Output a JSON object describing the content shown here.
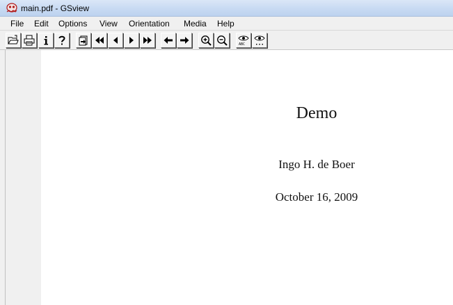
{
  "window": {
    "title": "main.pdf - GSview",
    "app_icon": "gsview-ghost-icon"
  },
  "menu": {
    "items": [
      {
        "label": "File"
      },
      {
        "label": "Edit"
      },
      {
        "label": "Options"
      },
      {
        "label": "View"
      },
      {
        "label": "Orientation"
      },
      {
        "label": "Media"
      },
      {
        "label": "Help"
      }
    ]
  },
  "toolbar": {
    "buttons": [
      {
        "icon": "open-folder-icon"
      },
      {
        "icon": "print-icon"
      },
      {
        "icon": "info-icon"
      },
      {
        "icon": "help-question-icon"
      },
      {
        "icon": "goto-page-icon"
      },
      {
        "icon": "first-page-icon"
      },
      {
        "icon": "previous-page-icon"
      },
      {
        "icon": "next-page-icon"
      },
      {
        "icon": "last-page-icon"
      },
      {
        "icon": "back-arrow-icon"
      },
      {
        "icon": "forward-arrow-icon"
      },
      {
        "icon": "zoom-in-icon"
      },
      {
        "icon": "zoom-out-icon"
      },
      {
        "icon": "find-text-icon"
      },
      {
        "icon": "find-next-icon"
      }
    ]
  },
  "document": {
    "title": "Demo",
    "author": "Ingo H. de Boer",
    "date": "October 16, 2009"
  }
}
